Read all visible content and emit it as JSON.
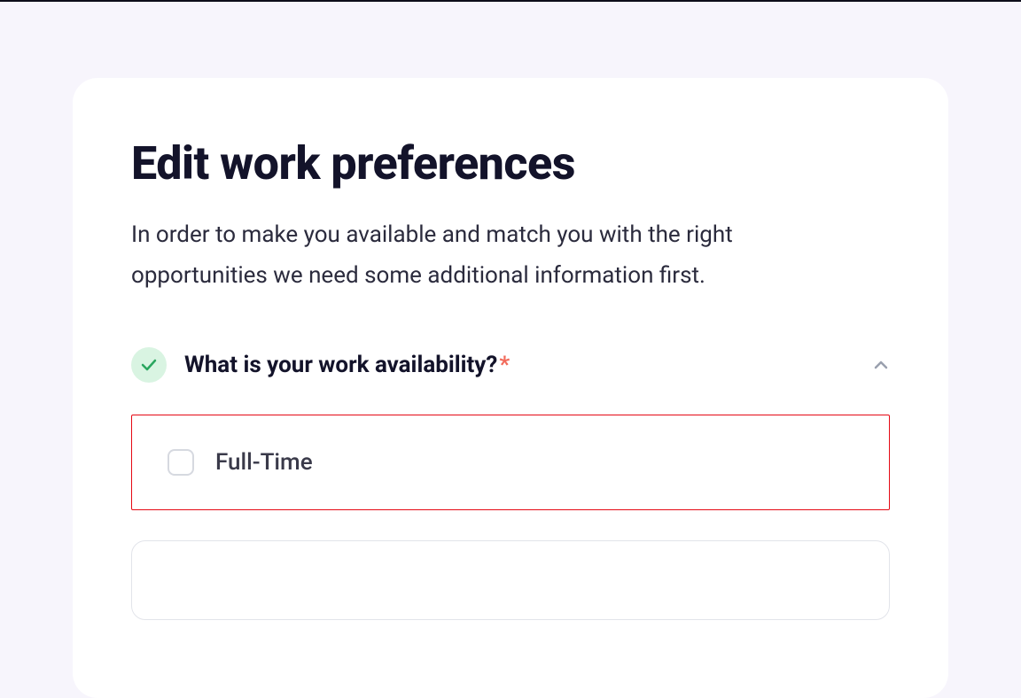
{
  "header": {
    "title": "Edit work preferences",
    "description": "In order to make you available and match you with the right opportunities we need some additional information first."
  },
  "question": {
    "label": "What is your work availability?",
    "required_indicator": "*",
    "expanded": true,
    "completed": true
  },
  "options": [
    {
      "label": "Full-Time",
      "checked": false,
      "highlighted": true
    }
  ]
}
